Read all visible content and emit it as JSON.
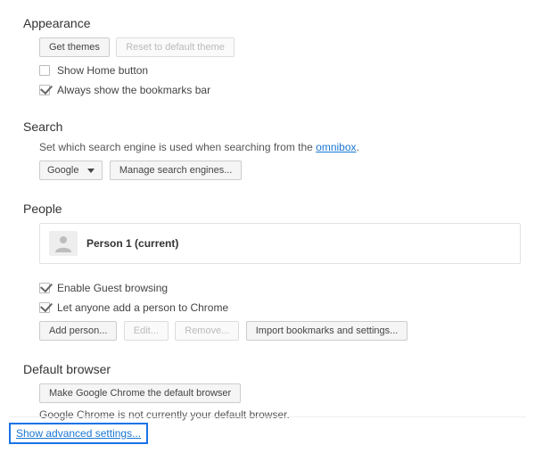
{
  "appearance": {
    "title": "Appearance",
    "get_themes": "Get themes",
    "reset_theme": "Reset to default theme",
    "show_home": "Show Home button",
    "show_bookmarks": "Always show the bookmarks bar"
  },
  "search": {
    "title": "Search",
    "help_prefix": "Set which search engine is used when searching from the ",
    "omnibox": "omnibox",
    "engine": "Google",
    "manage": "Manage search engines..."
  },
  "people": {
    "title": "People",
    "person_name": "Person 1 (current)",
    "guest": "Enable Guest browsing",
    "anyone_add": "Let anyone add a person to Chrome",
    "add_person": "Add person...",
    "edit": "Edit...",
    "remove": "Remove...",
    "import": "Import bookmarks and settings..."
  },
  "default_browser": {
    "title": "Default browser",
    "make_default": "Make Google Chrome the default browser",
    "status": "Google Chrome is not currently your default browser."
  },
  "footer": {
    "advanced": "Show advanced settings..."
  }
}
